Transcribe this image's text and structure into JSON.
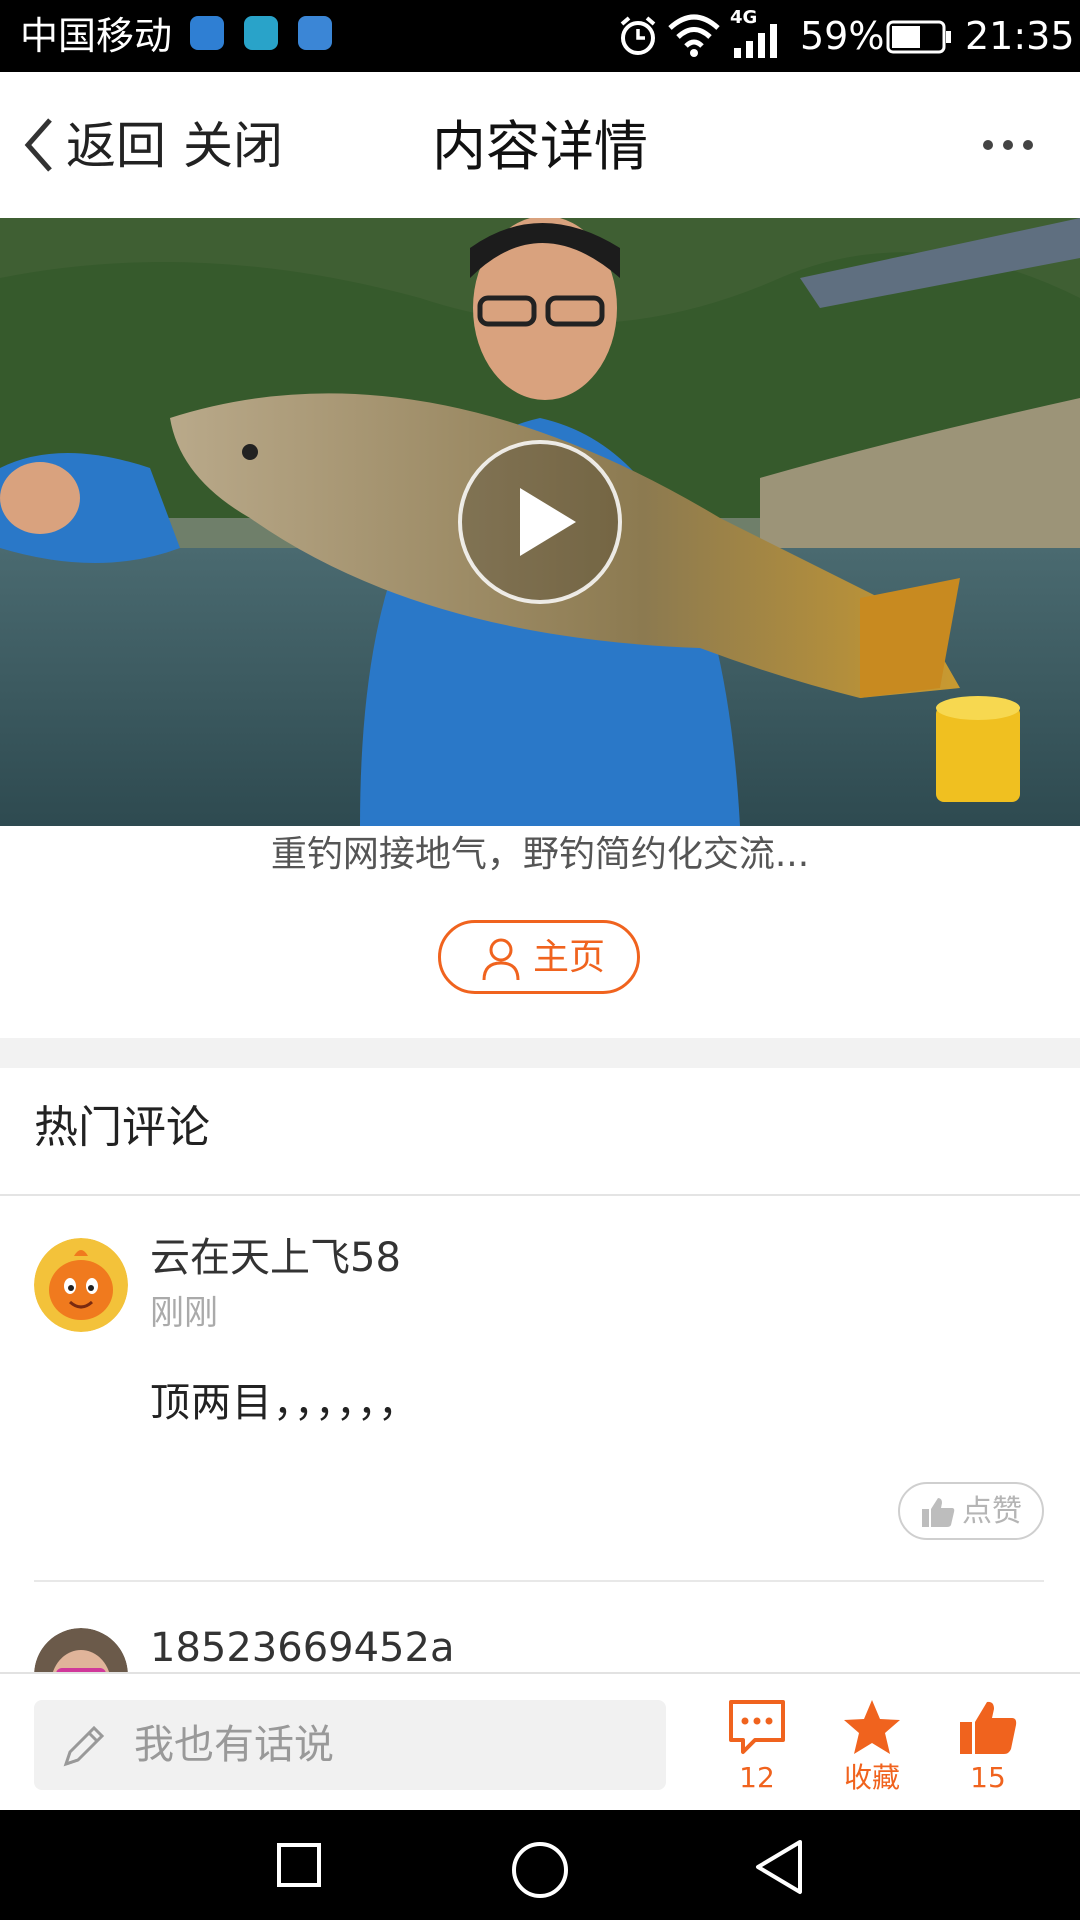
{
  "status_bar": {
    "carrier": "中国移动",
    "network": "4G",
    "battery": "59%",
    "time": "21:35",
    "app_icons": [
      "gallery-icon",
      "message-icon",
      "wifi-hotspot-icon"
    ]
  },
  "header": {
    "back_label": "返回",
    "close_label": "关闭",
    "title": "内容详情"
  },
  "video": {
    "caption": "重钓网接地气，野钓简约化交流..."
  },
  "homepage_button": {
    "label": "主页"
  },
  "hot_comments": {
    "title": "热门评论",
    "items": [
      {
        "user": "云在天上飞58",
        "time": "刚刚",
        "text": "顶两目，，，，，，",
        "like_label": "点赞"
      },
      {
        "user": "18523669452a"
      }
    ]
  },
  "bottom_bar": {
    "input_placeholder": "我也有话说",
    "comment_count": "12",
    "favorite_label": "收藏",
    "like_count": "15"
  },
  "colors": {
    "accent": "#f0631e",
    "status_bar": "#000000",
    "divider": "#e4e4e4"
  }
}
